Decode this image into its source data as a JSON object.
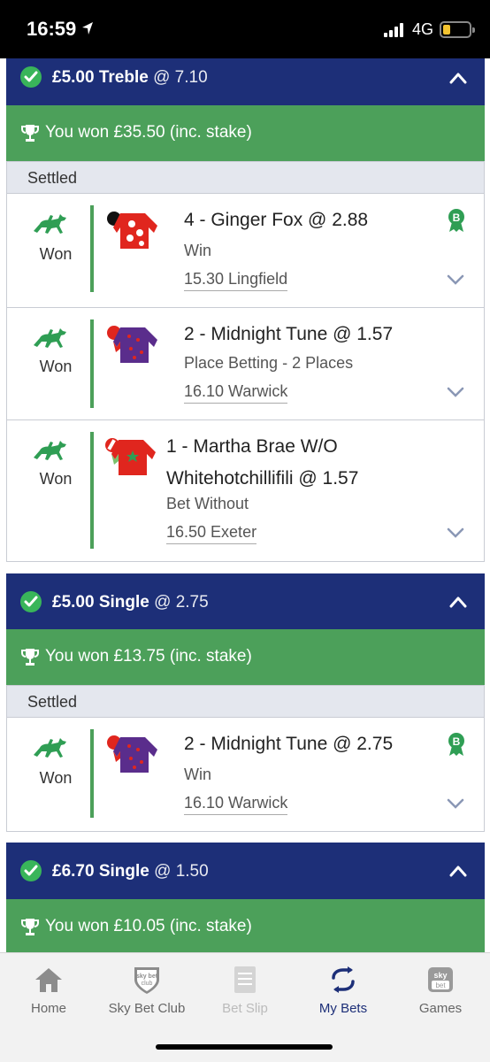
{
  "status_bar": {
    "time": "16:59",
    "network": "4G"
  },
  "bets": [
    {
      "stake": "£5.00",
      "type": "Treble",
      "odds": "@ 7.10",
      "result_text": "You won £35.50 (inc. stake)",
      "status": "Settled",
      "selections": [
        {
          "result": "Won",
          "name": "4 - Ginger Fox @ 2.88",
          "market": "Win",
          "event": "15.30 Lingfield",
          "badge": "B"
        },
        {
          "result": "Won",
          "name": "2 - Midnight Tune @ 1.57",
          "market": "Place Betting - 2 Places",
          "event": "16.10 Warwick"
        },
        {
          "result": "Won",
          "name_line1": "1 - Martha Brae W/O",
          "name_line2": "Whitehotchillifili @ 1.57",
          "market": "Bet Without",
          "event": "16.50 Exeter"
        }
      ]
    },
    {
      "stake": "£5.00",
      "type": "Single",
      "odds": "@ 2.75",
      "result_text": "You won £13.75 (inc. stake)",
      "status": "Settled",
      "selections": [
        {
          "result": "Won",
          "name": "2 - Midnight Tune @ 2.75",
          "market": "Win",
          "event": "16.10 Warwick",
          "badge": "B"
        }
      ]
    },
    {
      "stake": "£6.70",
      "type": "Single",
      "odds": "@ 1.50",
      "result_text": "You won £10.05 (inc. stake)"
    }
  ],
  "tabbar": {
    "home": "Home",
    "club": "Sky Bet Club",
    "club_icon_text_top": "sky bet",
    "club_icon_text_bottom": "club",
    "betslip": "Bet Slip",
    "mybets": "My Bets",
    "games": "Games",
    "games_icon_text_top": "sky",
    "games_icon_text_bottom": "bet"
  },
  "colors": {
    "header_navy": "#1d2f78",
    "won_green": "#4ca05a",
    "check_green": "#39b55a",
    "settled_grey": "#e4e7ee"
  }
}
